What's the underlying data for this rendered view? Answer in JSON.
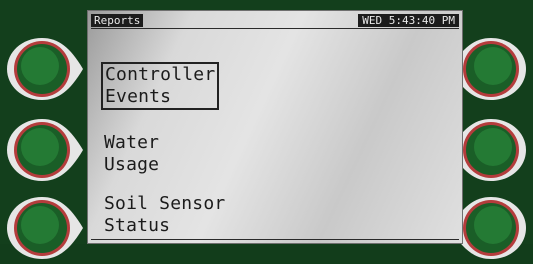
{
  "screen": {
    "title": "Reports",
    "clock": "WED 5:43:40 PM"
  },
  "menu": {
    "items": [
      {
        "line1": "Controller",
        "line2": "Events"
      },
      {
        "line1": "Water",
        "line2": "Usage"
      },
      {
        "line1": "Soil Sensor",
        "line2": "Status"
      }
    ]
  },
  "softkeys": {
    "left": [
      "softkey-arrow-right-icon",
      "softkey-arrow-right-icon",
      "softkey-arrow-right-icon"
    ],
    "right": [
      "softkey-arrow-left-icon",
      "softkey-arrow-left-icon",
      "softkey-arrow-left-icon"
    ]
  },
  "colors": {
    "bezel": "#133f1c",
    "button_face": "#1d6b2c",
    "button_ring": "#e5e5e5",
    "button_rim": "#b23a3a"
  }
}
